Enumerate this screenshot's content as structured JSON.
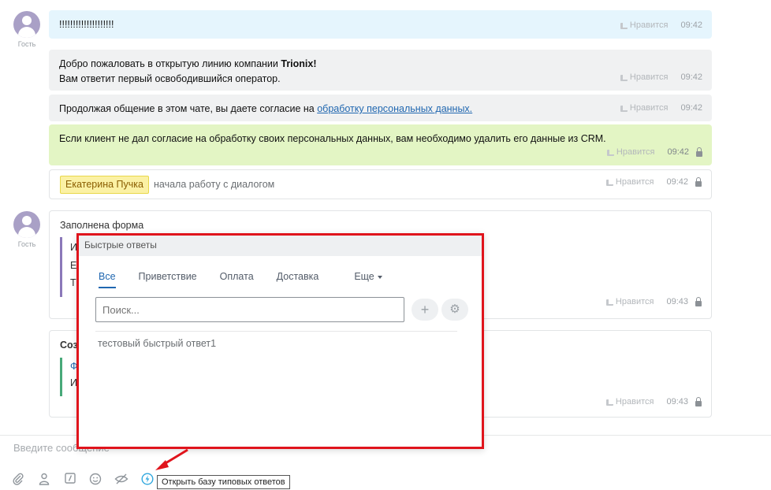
{
  "avatars": [
    {
      "label": "Гость"
    },
    {
      "label": "Гость"
    }
  ],
  "messages": {
    "m1": {
      "text": "!!!!!!!!!!!!!!!!!!!!",
      "like": "Нравится",
      "time": "09:42"
    },
    "m2": {
      "line1_prefix": "Добро пожаловать в открытую линию компании ",
      "line1_bold": "Trionix!",
      "line2": "Вам ответит первый освободившийся оператор.",
      "like": "Нравится",
      "time": "09:42"
    },
    "m3": {
      "prefix": "Продолжая общение в этом чате, вы даете согласие на ",
      "link": "обработку персональных данных.",
      "like": "Нравится",
      "time": "09:42"
    },
    "m4": {
      "text": "Если клиент не дал согласие на обработку своих персональных данных, вам необходимо удалить его данные из CRM.",
      "like": "Нравится",
      "time": "09:42"
    },
    "m5": {
      "operator": "Екатерина Пучка",
      "text": "начала работу с диалогом",
      "like": "Нравится",
      "time": "09:42"
    },
    "m6": {
      "title": "Заполнена форма",
      "q1": "И",
      "q2": "Е",
      "q3": "Т",
      "like": "Нравится",
      "time": "09:43"
    },
    "m7": {
      "title": "Соз",
      "q1": "Ф",
      "q2": "И",
      "like": "Нравится",
      "time": "09:43"
    }
  },
  "input": {
    "placeholder": "Введите сообщение"
  },
  "toolbar": {
    "tooltip": "Открыть базу типовых ответов"
  },
  "quick_answers": {
    "title": "Быстрые ответы",
    "tabs": [
      "Все",
      "Приветствие",
      "Оплата",
      "Доставка",
      "Еще"
    ],
    "search_placeholder": "Поиск...",
    "add_symbol": "+",
    "settings_symbol": "⚙",
    "items": [
      "тестовый быстрый ответ1"
    ]
  },
  "colors": {
    "highlight_border": "#e0141c",
    "link": "#2067b0",
    "accent": "#2fa7de"
  }
}
